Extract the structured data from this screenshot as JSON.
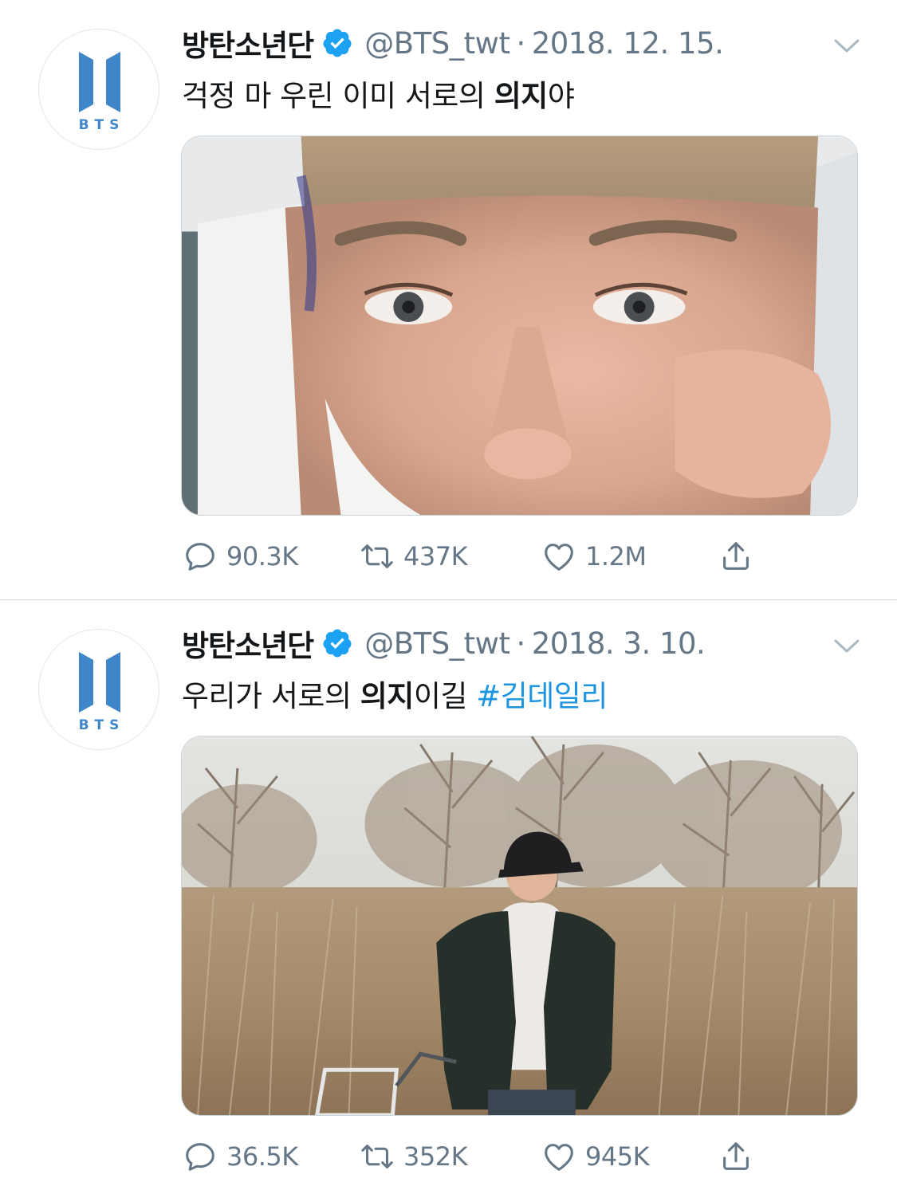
{
  "tweets": [
    {
      "author_name": "방탄소년단",
      "handle": "@BTS_twt",
      "separator": "·",
      "date": "2018. 12. 15.",
      "text_plain_1": "걱정 마 우린 이미 서로의 ",
      "text_bold": "의지",
      "text_plain_2": "야",
      "hashtag": "",
      "avatar_text": "BTS",
      "media_alt": "selfie photo",
      "stats": {
        "replies": "90.3K",
        "retweets": "437K",
        "likes": "1.2M"
      }
    },
    {
      "author_name": "방탄소년단",
      "handle": "@BTS_twt",
      "separator": "·",
      "date": "2018. 3. 10.",
      "text_plain_1": "우리가 서로의 ",
      "text_bold": "의지",
      "text_plain_2": "이길 ",
      "hashtag": "#김데일리",
      "avatar_text": "BTS",
      "media_alt": "photo in a field of dry reeds",
      "stats": {
        "replies": "36.5K",
        "retweets": "352K",
        "likes": "945K"
      }
    }
  ],
  "colors": {
    "accent": "#1b95e0",
    "text_primary": "#14171a",
    "text_secondary": "#657786",
    "logo_blue": "#3e86c8",
    "divider": "#d5d9dd"
  },
  "icons": [
    "reply-icon",
    "retweet-icon",
    "like-icon",
    "share-icon",
    "verified-badge-icon",
    "chevron-down-icon"
  ]
}
